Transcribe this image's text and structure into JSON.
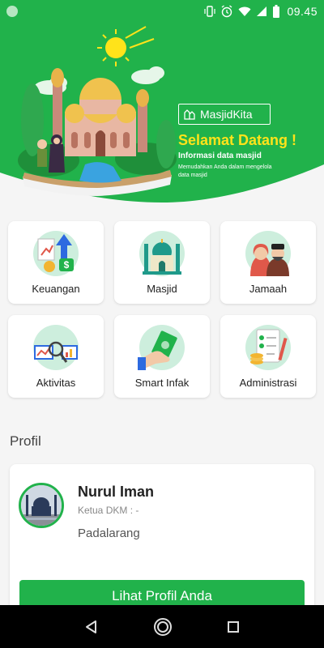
{
  "status_bar": {
    "time": "09.45",
    "icons": [
      "notification-dot-icon",
      "vibrate-icon",
      "alarm-icon",
      "wifi-icon",
      "signal-icon",
      "battery-icon"
    ]
  },
  "header": {
    "brand": "MasjidKita",
    "welcome": "Selamat Datang !",
    "info_title": "Informasi data masjid",
    "info_subtitle": "Memudahkan Anda dalam mengelola data masjid",
    "colors": {
      "primary": "#21b24b",
      "accent": "#ffe31a"
    }
  },
  "menu": [
    {
      "label": "Keuangan",
      "icon": "finance-icon"
    },
    {
      "label": "Masjid",
      "icon": "mosque-icon"
    },
    {
      "label": "Jamaah",
      "icon": "congregation-icon"
    },
    {
      "label": "Aktivitas",
      "icon": "activity-icon"
    },
    {
      "label": "Smart Infak",
      "icon": "donation-icon"
    },
    {
      "label": "Administrasi",
      "icon": "administration-icon"
    }
  ],
  "profile": {
    "section_title": "Profil",
    "name": "Nurul Iman",
    "role": "Ketua DKM : -",
    "location": "Padalarang",
    "button_label": "Lihat Profil Anda"
  },
  "nav_bar": {
    "icons": [
      "back-icon",
      "home-icon",
      "recents-icon"
    ]
  }
}
